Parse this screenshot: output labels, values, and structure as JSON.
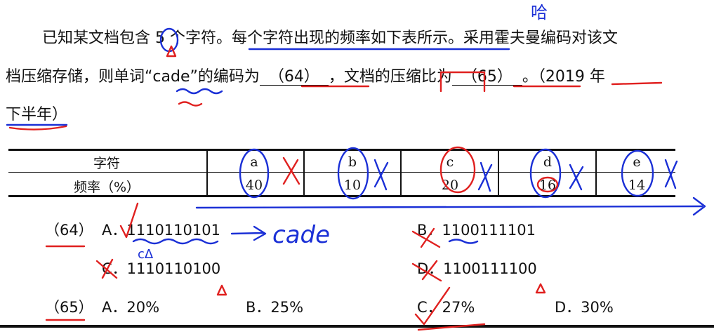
{
  "question": {
    "line1": "已知某文档包含 5 个字符。每个字符出现的频率如下表所示。采用霍夫曼编码对该文",
    "line2_pre": "档压缩存储，则单词“cade”的编码为",
    "blank64": "（64）",
    "line2_mid": "，文档的压缩比为",
    "blank65": "（65）",
    "line2_post": "。（2019 年",
    "line3": "下半年）"
  },
  "table": {
    "row_headers": [
      "字符",
      "频率（%）"
    ],
    "chars": [
      "a",
      "b",
      "c",
      "d",
      "e"
    ],
    "freqs": [
      "40",
      "10",
      "20",
      "16",
      "14"
    ]
  },
  "q64": {
    "number": "（64）",
    "A": "A．1110110101",
    "B": "B．1100111101",
    "C": "C．1110110100",
    "D": "D．1100111100"
  },
  "q65": {
    "number": "（65）",
    "A": "A．20%",
    "B": "B．25%",
    "C": "C．27%",
    "D": "D．30%"
  },
  "handwriting": {
    "note_top": "哈",
    "note_cade": "cade",
    "note_c": "cᐃ",
    "ink_blue": "#1a2fd6",
    "ink_red": "#e0201f"
  }
}
